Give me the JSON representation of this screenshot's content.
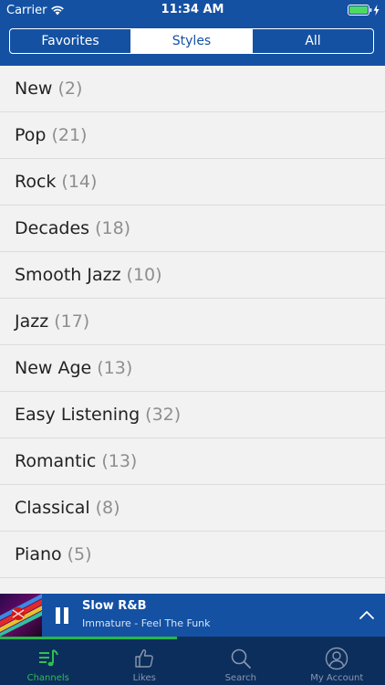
{
  "status_bar": {
    "carrier": "Carrier",
    "time": "11:34 AM"
  },
  "segmented_control": {
    "segments": [
      {
        "label": "Favorites",
        "active": false
      },
      {
        "label": "Styles",
        "active": true
      },
      {
        "label": "All",
        "active": false
      }
    ]
  },
  "styles_list": [
    {
      "name": "New",
      "count": "(2)"
    },
    {
      "name": "Pop",
      "count": "(21)"
    },
    {
      "name": "Rock",
      "count": "(14)"
    },
    {
      "name": "Decades",
      "count": "(18)"
    },
    {
      "name": "Smooth Jazz",
      "count": "(10)"
    },
    {
      "name": "Jazz",
      "count": "(17)"
    },
    {
      "name": "New Age",
      "count": "(13)"
    },
    {
      "name": "Easy Listening",
      "count": "(32)"
    },
    {
      "name": "Romantic",
      "count": "(13)"
    },
    {
      "name": "Classical",
      "count": "(8)"
    },
    {
      "name": "Piano",
      "count": "(5)"
    }
  ],
  "now_playing": {
    "station": "Slow R&B",
    "track": "Immature - Feel The Funk",
    "progress_fraction": 0.46
  },
  "tab_bar": {
    "tabs": [
      {
        "label": "Channels",
        "icon": "music-list-icon",
        "active": true
      },
      {
        "label": "Likes",
        "icon": "thumbs-up-icon",
        "active": false
      },
      {
        "label": "Search",
        "icon": "search-icon",
        "active": false
      },
      {
        "label": "My Account",
        "icon": "account-icon",
        "active": false
      }
    ]
  },
  "colors": {
    "brand_blue": "#1451a3",
    "tab_bar_navy": "#0c2e5c",
    "accent_green": "#2fbf4f",
    "list_background": "#f2f2f2"
  }
}
